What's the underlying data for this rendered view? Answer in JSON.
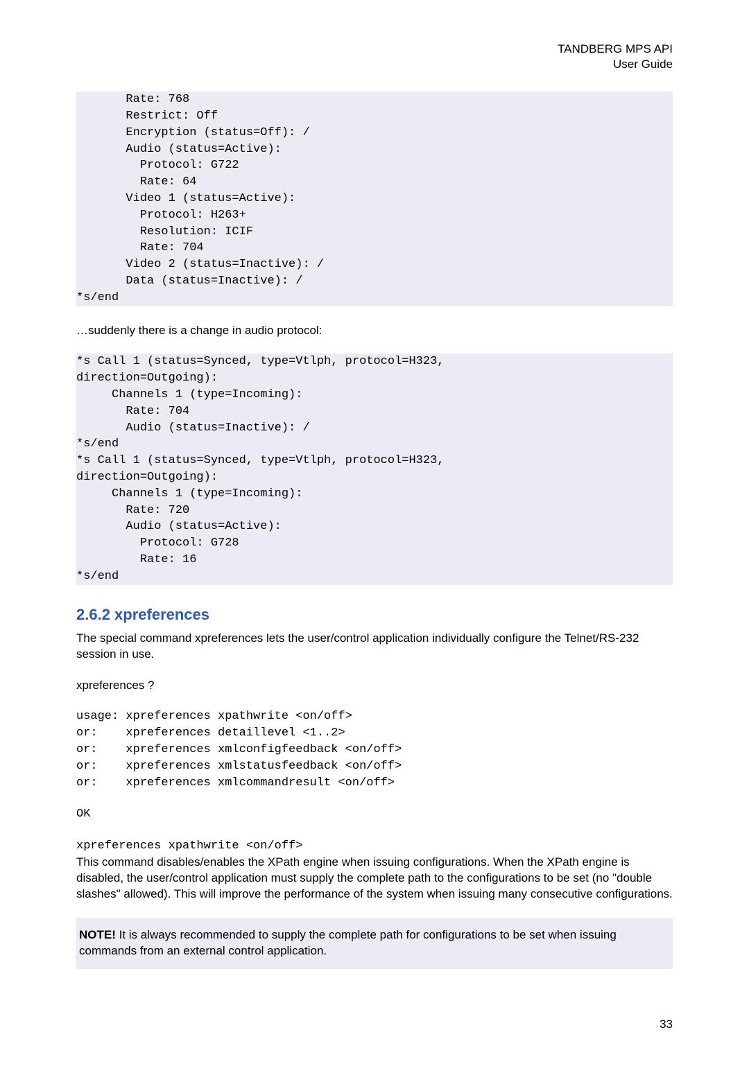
{
  "header": {
    "line1": "TANDBERG MPS API",
    "line2": "User Guide"
  },
  "code1": "       Rate: 768\n       Restrict: Off\n       Encryption (status=Off): /\n       Audio (status=Active):\n         Protocol: G722\n         Rate: 64\n       Video 1 (status=Active):\n         Protocol: H263+\n         Resolution: ICIF\n         Rate: 704\n       Video 2 (status=Inactive): /\n       Data (status=Inactive): /\n*s/end",
  "para1": "…suddenly there is a change in audio protocol:",
  "code2": "*s Call 1 (status=Synced, type=Vtlph, protocol=H323,\ndirection=Outgoing):\n     Channels 1 (type=Incoming):\n       Rate: 704\n       Audio (status=Inactive): /\n*s/end\n*s Call 1 (status=Synced, type=Vtlph, protocol=H323,\ndirection=Outgoing):\n     Channels 1 (type=Incoming):\n       Rate: 720\n       Audio (status=Active):\n         Protocol: G728\n         Rate: 16\n*s/end",
  "section_title": "2.6.2 xpreferences",
  "para2": "The special command xpreferences lets the user/control application individually configure the Telnet/RS-232 session in use.",
  "para3": "xpreferences ?",
  "code3": "usage: xpreferences xpathwrite <on/off>\nor:    xpreferences detaillevel <1..2>\nor:    xpreferences xmlconfigfeedback <on/off>\nor:    xpreferences xmlstatusfeedback <on/off>\nor:    xpreferences xmlcommandresult <on/off>",
  "para_ok": "OK",
  "para_cmd": "xpreferences xpathwrite <on/off>",
  "para4": "This command disables/enables the XPath engine when issuing configurations. When the XPath engine is disabled, the user/control application must supply the complete path to the configurations to be set (no \"double slashes\" allowed). This will improve the performance of the system when issuing many consecutive configurations.",
  "note_bold": "NOTE!",
  "note_text": " It is always recommended to supply the complete path for configurations to be set when issuing commands from an external control application.",
  "page_num": "33"
}
